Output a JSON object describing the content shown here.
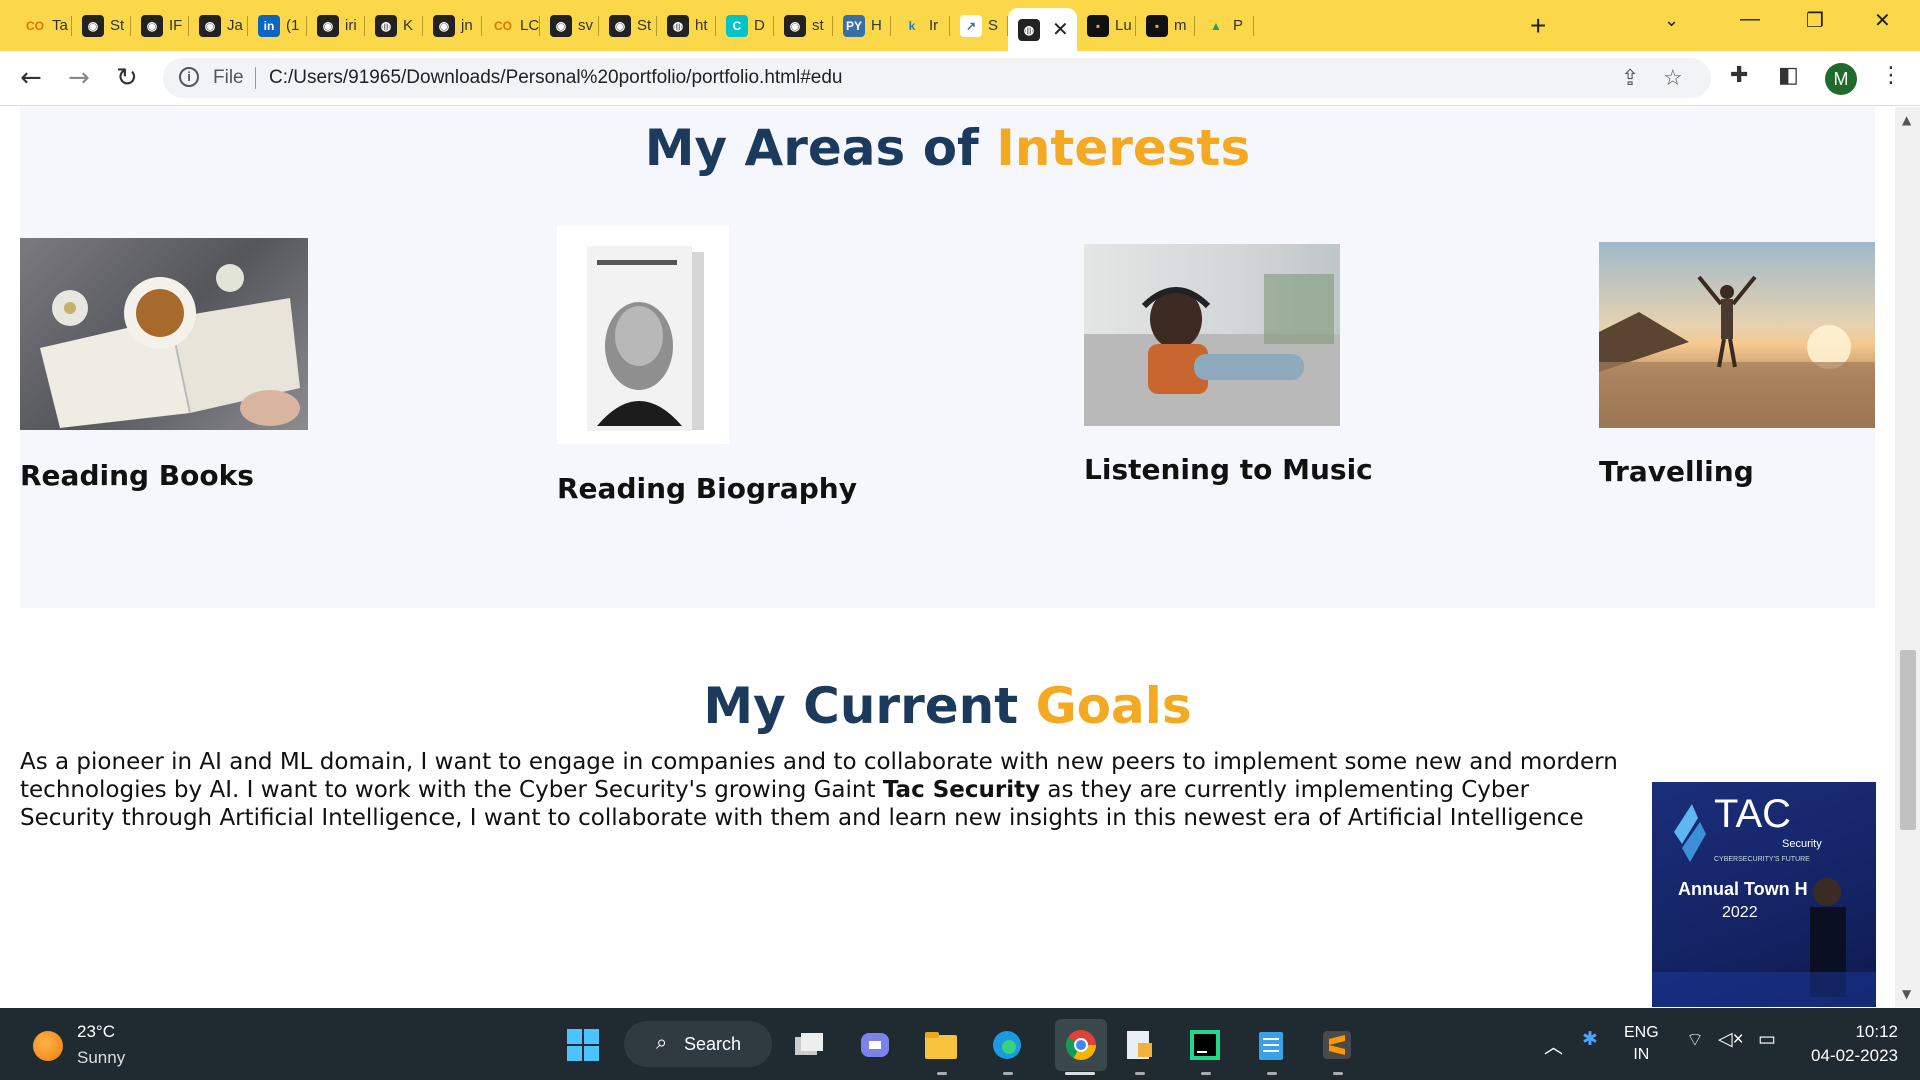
{
  "browser": {
    "tabs": [
      {
        "label": "Ta",
        "icon": "colab-icon"
      },
      {
        "label": "St",
        "icon": "github-icon"
      },
      {
        "label": "IF",
        "icon": "github-icon"
      },
      {
        "label": "Ja",
        "icon": "github-icon"
      },
      {
        "label": "(1",
        "icon": "linkedin-icon"
      },
      {
        "label": "iri",
        "icon": "github-icon"
      },
      {
        "label": "K",
        "icon": "globe-icon"
      },
      {
        "label": "jn",
        "icon": "github-icon"
      },
      {
        "label": "LC",
        "icon": "colab-icon"
      },
      {
        "label": "sv",
        "icon": "github-icon"
      },
      {
        "label": "St",
        "icon": "github-icon"
      },
      {
        "label": "ht",
        "icon": "globe-icon"
      },
      {
        "label": "D",
        "icon": "canva-icon"
      },
      {
        "label": "st",
        "icon": "github-icon"
      },
      {
        "label": "H",
        "icon": "python-icon"
      },
      {
        "label": "Ir",
        "icon": "k-icon"
      },
      {
        "label": "S",
        "icon": "chart-icon"
      },
      {
        "label": "",
        "icon": "globe-icon",
        "active": true
      },
      {
        "label": "Lu",
        "icon": "dark-icon"
      },
      {
        "label": "m",
        "icon": "dark-icon"
      },
      {
        "label": "P",
        "icon": "drive-icon"
      }
    ],
    "url_scheme": "File",
    "url": "C:/Users/91965/Downloads/Personal%20portfolio/portfolio.html#edu",
    "profile_initial": "M"
  },
  "interests": {
    "title_main": "My Areas of ",
    "title_accent": "Interests",
    "cards": [
      {
        "label": "Reading Books"
      },
      {
        "label": "Reading Biography"
      },
      {
        "label": "Listening to Music"
      },
      {
        "label": "Travelling"
      }
    ]
  },
  "goals": {
    "title_main": "My Current ",
    "title_accent": "Goals",
    "text_before": "As a pioneer in AI and ML domain, I want to engage in companies and to collaborate with new peers to implement some new and mordern technologies by AI. I want to work with the Cyber Security's growing Gaint ",
    "text_bold": "Tac Security",
    "text_after": " as they are currently implementing Cyber Security through Artificial Intelligence, I want to collaborate with them and learn new insights in this newest era of Artificial Intelligence",
    "image_brand": "TAC",
    "image_brand_sub": "Security",
    "image_tagline": "CYBERSECURITY'S FUTURE",
    "image_event": "Annual Town H",
    "image_year": "2022"
  },
  "taskbar": {
    "temperature": "23°C",
    "weather": "Sunny",
    "search_label": "Search",
    "lang_1": "ENG",
    "lang_2": "IN",
    "time": "10:12",
    "date": "04-02-2023"
  }
}
